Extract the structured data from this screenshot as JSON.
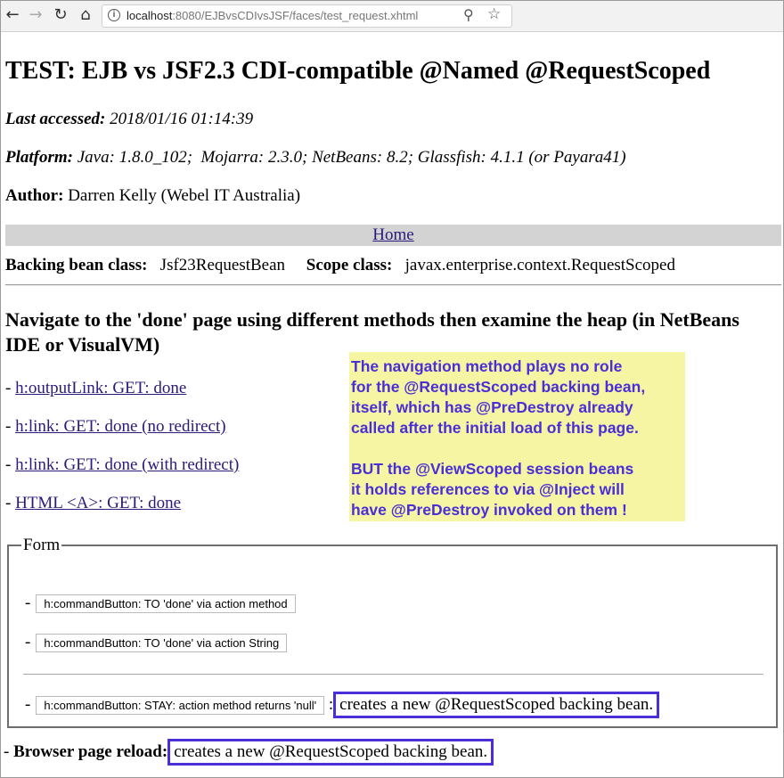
{
  "browser": {
    "url_host": "localhost",
    "url_path": ":8080/EJBvsCDIvsJSF/faces/test_request.xhtml",
    "icons": [
      "back-arrow-icon",
      "forward-arrow-icon",
      "reload-icon",
      "home-icon",
      "info-icon",
      "zoom-icon",
      "star-icon"
    ]
  },
  "page": {
    "title": "TEST: EJB vs JSF2.3 CDI-compatible @Named @RequestScoped",
    "last_accessed_label": "Last accessed:",
    "last_accessed_value": "2018/01/16 01:14:39",
    "platform_label": "Platform:",
    "platform_value": "Java: 1.8.0_102;  Mojarra: 2.3.0; NetBeans: 8.2; Glassfish: 4.1.1 (or Payara41)",
    "author_label": "Author:",
    "author_value": "Darren Kelly (Webel IT Australia)",
    "home_link": "Home",
    "bean_label": "Backing bean class:",
    "bean_value": "Jsf23RequestBean",
    "scope_label": "Scope class:",
    "scope_value": "javax.enterprise.context.RequestScoped",
    "heading": "Navigate to the 'done' page using different methods then examine the heap (in NetBeans IDE or VisualVM)",
    "dash": "- ",
    "links": [
      "h:outputLink: GET: done",
      "h:link: GET: done (no redirect)",
      "h:link: GET: done (with redirect)",
      "HTML <A>: GET: done"
    ],
    "note_lines": [
      "The navigation method plays no role",
      "for the @RequestScoped backing bean,",
      "itself, which has @PreDestroy already",
      "called after the initial load of this page.",
      "",
      "BUT the @ViewScoped session beans",
      "it holds references to via @Inject will",
      "have @PreDestroy invoked on them !"
    ],
    "form": {
      "legend": "Form",
      "button1": "h:commandButton: TO 'done' via action method",
      "button2": "h:commandButton: TO 'done' via action String",
      "button3": "h:commandButton: STAY: action method returns 'null'",
      "button3_suffix": ":",
      "button3_note": "creates a new @RequestScoped backing bean."
    },
    "reload_label": "Browser page reload:",
    "reload_note": "creates a new @RequestScoped backing bean.",
    "highlight_color": "#4a2ed6",
    "note_bg_color": "#f6f5a4"
  }
}
